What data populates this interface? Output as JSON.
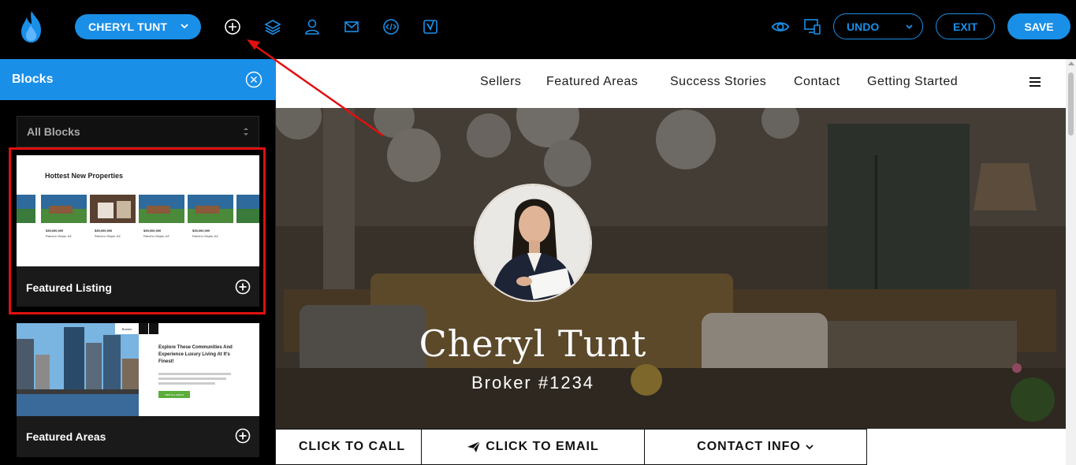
{
  "toolbar": {
    "site_name": "CHERYL TUNT",
    "icons": [
      "add-circle-icon",
      "layers-icon",
      "user-icon",
      "mail-icon",
      "code-icon",
      "yoast-icon",
      "eye-icon",
      "responsive-icon"
    ],
    "undo_label": "UNDO",
    "exit_label": "EXIT",
    "save_label": "SAVE",
    "accent_color": "#1a8fe8"
  },
  "site": {
    "nav": [
      "Sellers",
      "Featured Areas",
      "Success Stories",
      "Contact",
      "Getting Started"
    ],
    "hero_name": "Cheryl Tunt",
    "hero_subtitle": "Broker #1234",
    "cta": [
      "CLICK TO CALL",
      "CLICK TO EMAIL",
      "CONTACT INFO"
    ]
  },
  "panel": {
    "title": "Blocks",
    "filter_value": "All Blocks",
    "cards": [
      {
        "label": "Featured Listing",
        "thumb_heading": "Hottest New Properties",
        "thumb_price": "$35,000,000",
        "thumb_location": "Rancho Viejas, AZ"
      },
      {
        "label": "Featured Areas",
        "thumb_heading": "Explore These Communities And Experience Luxury Living At It's Finest!",
        "thumb_tab": "Boston",
        "thumb_button": "VIEW ALL AREAS"
      }
    ],
    "highlight_color": "#e01010"
  }
}
